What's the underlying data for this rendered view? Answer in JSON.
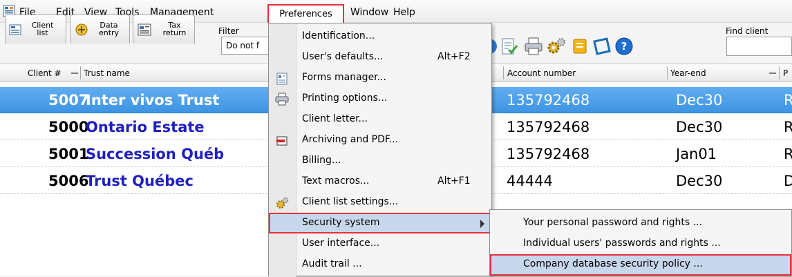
{
  "menubar": {
    "items": [
      {
        "id": "file",
        "label": "File"
      },
      {
        "id": "edit",
        "label": "Edit"
      },
      {
        "id": "view",
        "label": "View"
      },
      {
        "id": "tools",
        "label": "Tools"
      },
      {
        "id": "management",
        "label": "Management"
      },
      {
        "id": "preferences",
        "label": "Preferences"
      },
      {
        "id": "window",
        "label": "Window"
      },
      {
        "id": "help",
        "label": "Help"
      }
    ]
  },
  "toolbar": {
    "tabs": [
      {
        "line1": "Client",
        "line2": "list"
      },
      {
        "line1": "Data",
        "line2": "entry"
      },
      {
        "line1": "Tax",
        "line2": "return"
      }
    ],
    "filter_label": "Filter",
    "filter_value": "Do not f",
    "find_label": "Find client",
    "find_value": ""
  },
  "grid": {
    "columns": {
      "client_num": "Client #",
      "trust_name": "Trust name",
      "account_number": "Account number",
      "year_end": "Year-end",
      "next": "P"
    },
    "rows": [
      {
        "client": "5007",
        "name": "Inter vivos Trust",
        "account": "135792468",
        "yearend": "Dec30",
        "next": "R",
        "selected": true
      },
      {
        "client": "5000",
        "name": "Ontario Estate",
        "account": "135792468",
        "yearend": "Dec30",
        "next": "R",
        "selected": false
      },
      {
        "client": "5001",
        "name": "Succession Québ",
        "account": "135792468",
        "yearend": "Jan01",
        "next": "R",
        "selected": false
      },
      {
        "client": "5006",
        "name": "Trust Québec",
        "account": "44444",
        "yearend": "Dec30",
        "next": "D",
        "selected": false
      }
    ]
  },
  "preferences_menu": {
    "items": [
      {
        "label": "Identification...",
        "shortcut": ""
      },
      {
        "label": "User's defaults...",
        "shortcut": "Alt+F2"
      },
      {
        "label": "Forms manager...",
        "shortcut": ""
      },
      {
        "label": "Printing options...",
        "shortcut": ""
      },
      {
        "label": "Client letter...",
        "shortcut": ""
      },
      {
        "label": "Archiving and PDF...",
        "shortcut": ""
      },
      {
        "label": "Billing...",
        "shortcut": ""
      },
      {
        "label": "Text macros...",
        "shortcut": "Alt+F1"
      },
      {
        "label": "Client list settings...",
        "shortcut": ""
      },
      {
        "label": "Security system",
        "shortcut": ""
      },
      {
        "label": "User interface...",
        "shortcut": ""
      },
      {
        "label": "Audit trail ...",
        "shortcut": ""
      }
    ]
  },
  "security_submenu": {
    "items": [
      {
        "label": "Your personal password and rights ..."
      },
      {
        "label": "Individual users' passwords and rights ..."
      },
      {
        "label": "Company database security policy ..."
      }
    ]
  },
  "colors": {
    "highlight_border": "#e8303a",
    "selected_row": "#3d94e3",
    "trust_name": "#1f1fc0",
    "menu_hover": "#c7d7ec"
  }
}
